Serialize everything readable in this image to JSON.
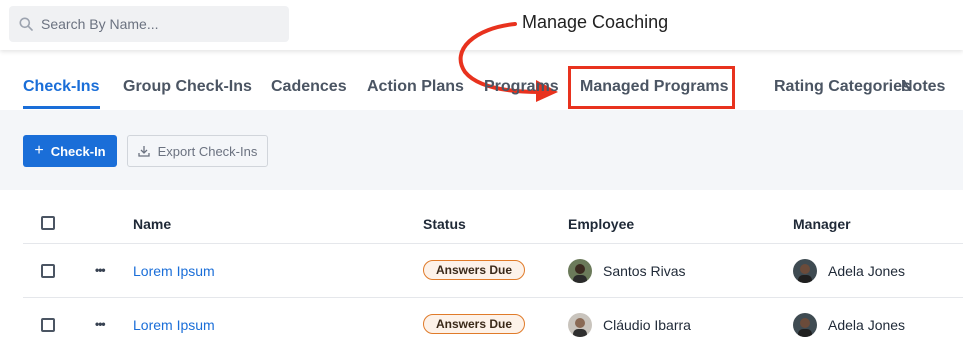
{
  "search": {
    "placeholder": "Search By Name..."
  },
  "annotation": {
    "label": "Manage Coaching",
    "color": "#e8321e"
  },
  "tabs": [
    {
      "label": "Check-Ins",
      "active": true
    },
    {
      "label": "Group Check-Ins"
    },
    {
      "label": "Cadences"
    },
    {
      "label": "Action Plans"
    },
    {
      "label": "Programs"
    },
    {
      "label": "Managed Programs",
      "highlighted": true
    },
    {
      "label": "Rating Categories"
    },
    {
      "label": "Notes"
    }
  ],
  "toolbar": {
    "primary_label": "Check-In",
    "secondary_label": "Export Check-Ins"
  },
  "table": {
    "columns": [
      "Name",
      "Status",
      "Employee",
      "Manager"
    ],
    "rows": [
      {
        "name": "Lorem Ipsum",
        "status": "Answers Due",
        "employee": "Santos Rivas",
        "manager": "Adela Jones"
      },
      {
        "name": "Lorem Ipsum",
        "status": "Answers Due",
        "employee": "Cláudio Ibarra",
        "manager": "Adela Jones"
      }
    ]
  },
  "colors": {
    "accent": "#1a6ed8",
    "badge_border": "#e07b2a",
    "badge_bg": "#fdf2e9",
    "annotation": "#e8321e"
  }
}
